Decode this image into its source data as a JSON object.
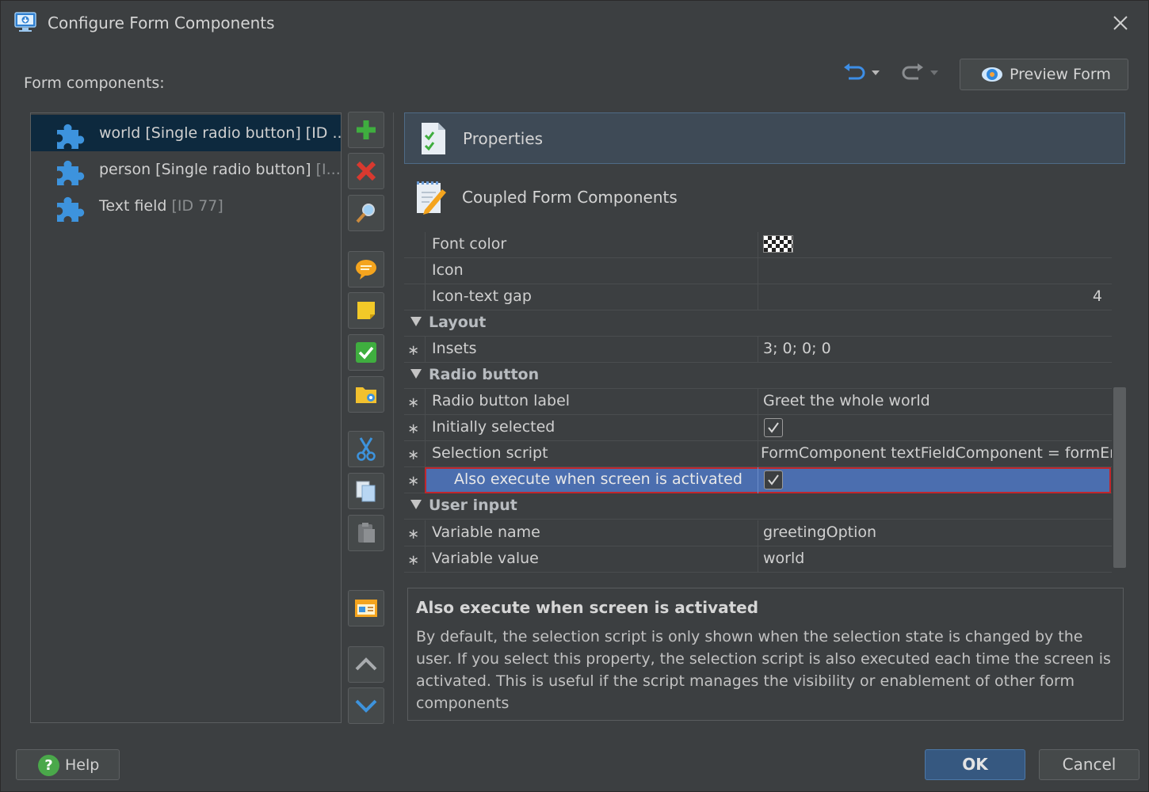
{
  "window": {
    "title": "Configure Form Components"
  },
  "components_label": "Form components:",
  "toolbar_top": {
    "preview_label": "Preview Form"
  },
  "components": [
    {
      "name": "world [Single radio button] [ID ...",
      "dim": "",
      "selected": true
    },
    {
      "name": "person [Single radio button] ",
      "dim": "[I...",
      "selected": false
    },
    {
      "name": "Text field ",
      "dim": "[ID 77]",
      "selected": false
    }
  ],
  "side_tools": [
    "add-icon",
    "delete-icon",
    "search-icon",
    "comment-icon",
    "note-icon",
    "check-icon",
    "folder-icon",
    "cut-icon",
    "copy-icon",
    "paste-icon",
    "screen-icon",
    "move-up-icon",
    "move-down-icon"
  ],
  "tabs": {
    "properties": "Properties",
    "coupled": "Coupled Form Components"
  },
  "properties": {
    "font_color": {
      "name": "Font color"
    },
    "icon": {
      "name": "Icon",
      "value": ""
    },
    "icon_text_gap": {
      "name": "Icon-text gap",
      "value": "4"
    },
    "layout_section": "Layout",
    "insets": {
      "name": "Insets",
      "value": "3; 0; 0; 0"
    },
    "radio_section": "Radio button",
    "radio_label": {
      "name": "Radio button label",
      "value": "Greet the whole world"
    },
    "initially_selected": {
      "name": "Initially selected",
      "checked": true
    },
    "selection_script": {
      "name": "Selection script",
      "value": "FormComponent textFieldComponent = formEn"
    },
    "also_execute": {
      "name": "Also execute when screen is activated",
      "checked": true
    },
    "user_input_section": "User input",
    "variable_name": {
      "name": "Variable name",
      "value": "greetingOption"
    },
    "variable_value": {
      "name": "Variable value",
      "value": "world"
    }
  },
  "star": "∗",
  "description": {
    "title": "Also execute when screen is activated",
    "body": "By default, the selection script is only shown when the selection state is changed by the user. If you select this property, the selection script is also executed each time the screen is activated. This is useful if the script manages the visibility or enablement of other form components"
  },
  "buttons": {
    "help": "Help",
    "ok": "OK",
    "cancel": "Cancel"
  },
  "colors": {
    "accent": "#4b6eaf",
    "selection_border": "#c0262c",
    "ok_button": "#365880"
  }
}
